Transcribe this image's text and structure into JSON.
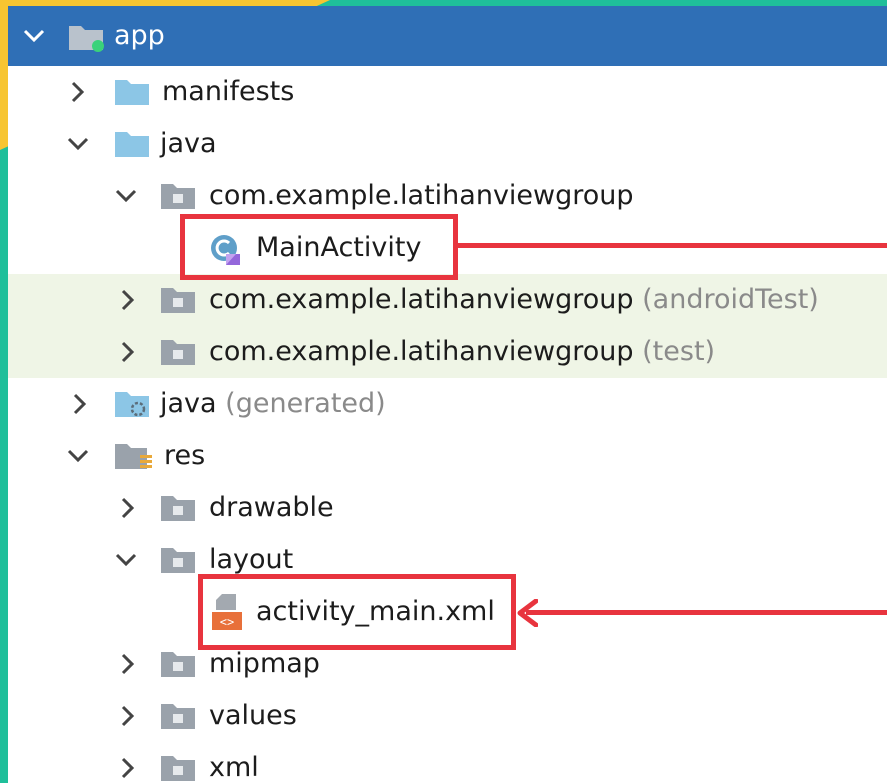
{
  "tree": {
    "root": {
      "label": "app"
    },
    "items": [
      {
        "label": "manifests",
        "icon": "folder-icon"
      },
      {
        "label": "java",
        "icon": "folder-icon"
      },
      {
        "label": "com.example.latihanviewgroup",
        "icon": "package-icon"
      },
      {
        "label": "MainActivity",
        "icon": "kotlin-class-icon"
      },
      {
        "label": "com.example.latihanviewgroup",
        "suffix": "(androidTest)",
        "icon": "package-icon"
      },
      {
        "label": "com.example.latihanviewgroup",
        "suffix": "(test)",
        "icon": "package-icon"
      },
      {
        "label": "java",
        "suffix": "(generated)",
        "icon": "generated-folder-icon"
      },
      {
        "label": "res",
        "icon": "resource-folder-icon"
      },
      {
        "label": "drawable",
        "icon": "package-icon"
      },
      {
        "label": "layout",
        "icon": "package-icon"
      },
      {
        "label": "activity_main.xml",
        "icon": "xml-file-icon"
      },
      {
        "label": "mipmap",
        "icon": "package-icon"
      },
      {
        "label": "values",
        "icon": "package-icon"
      },
      {
        "label": "xml",
        "icon": "package-icon"
      }
    ]
  },
  "colors": {
    "selection": "#2f6fb6",
    "highlight": "#e8343e",
    "tinted_row": "#eff5e6",
    "folder": "#8cc6e6"
  }
}
